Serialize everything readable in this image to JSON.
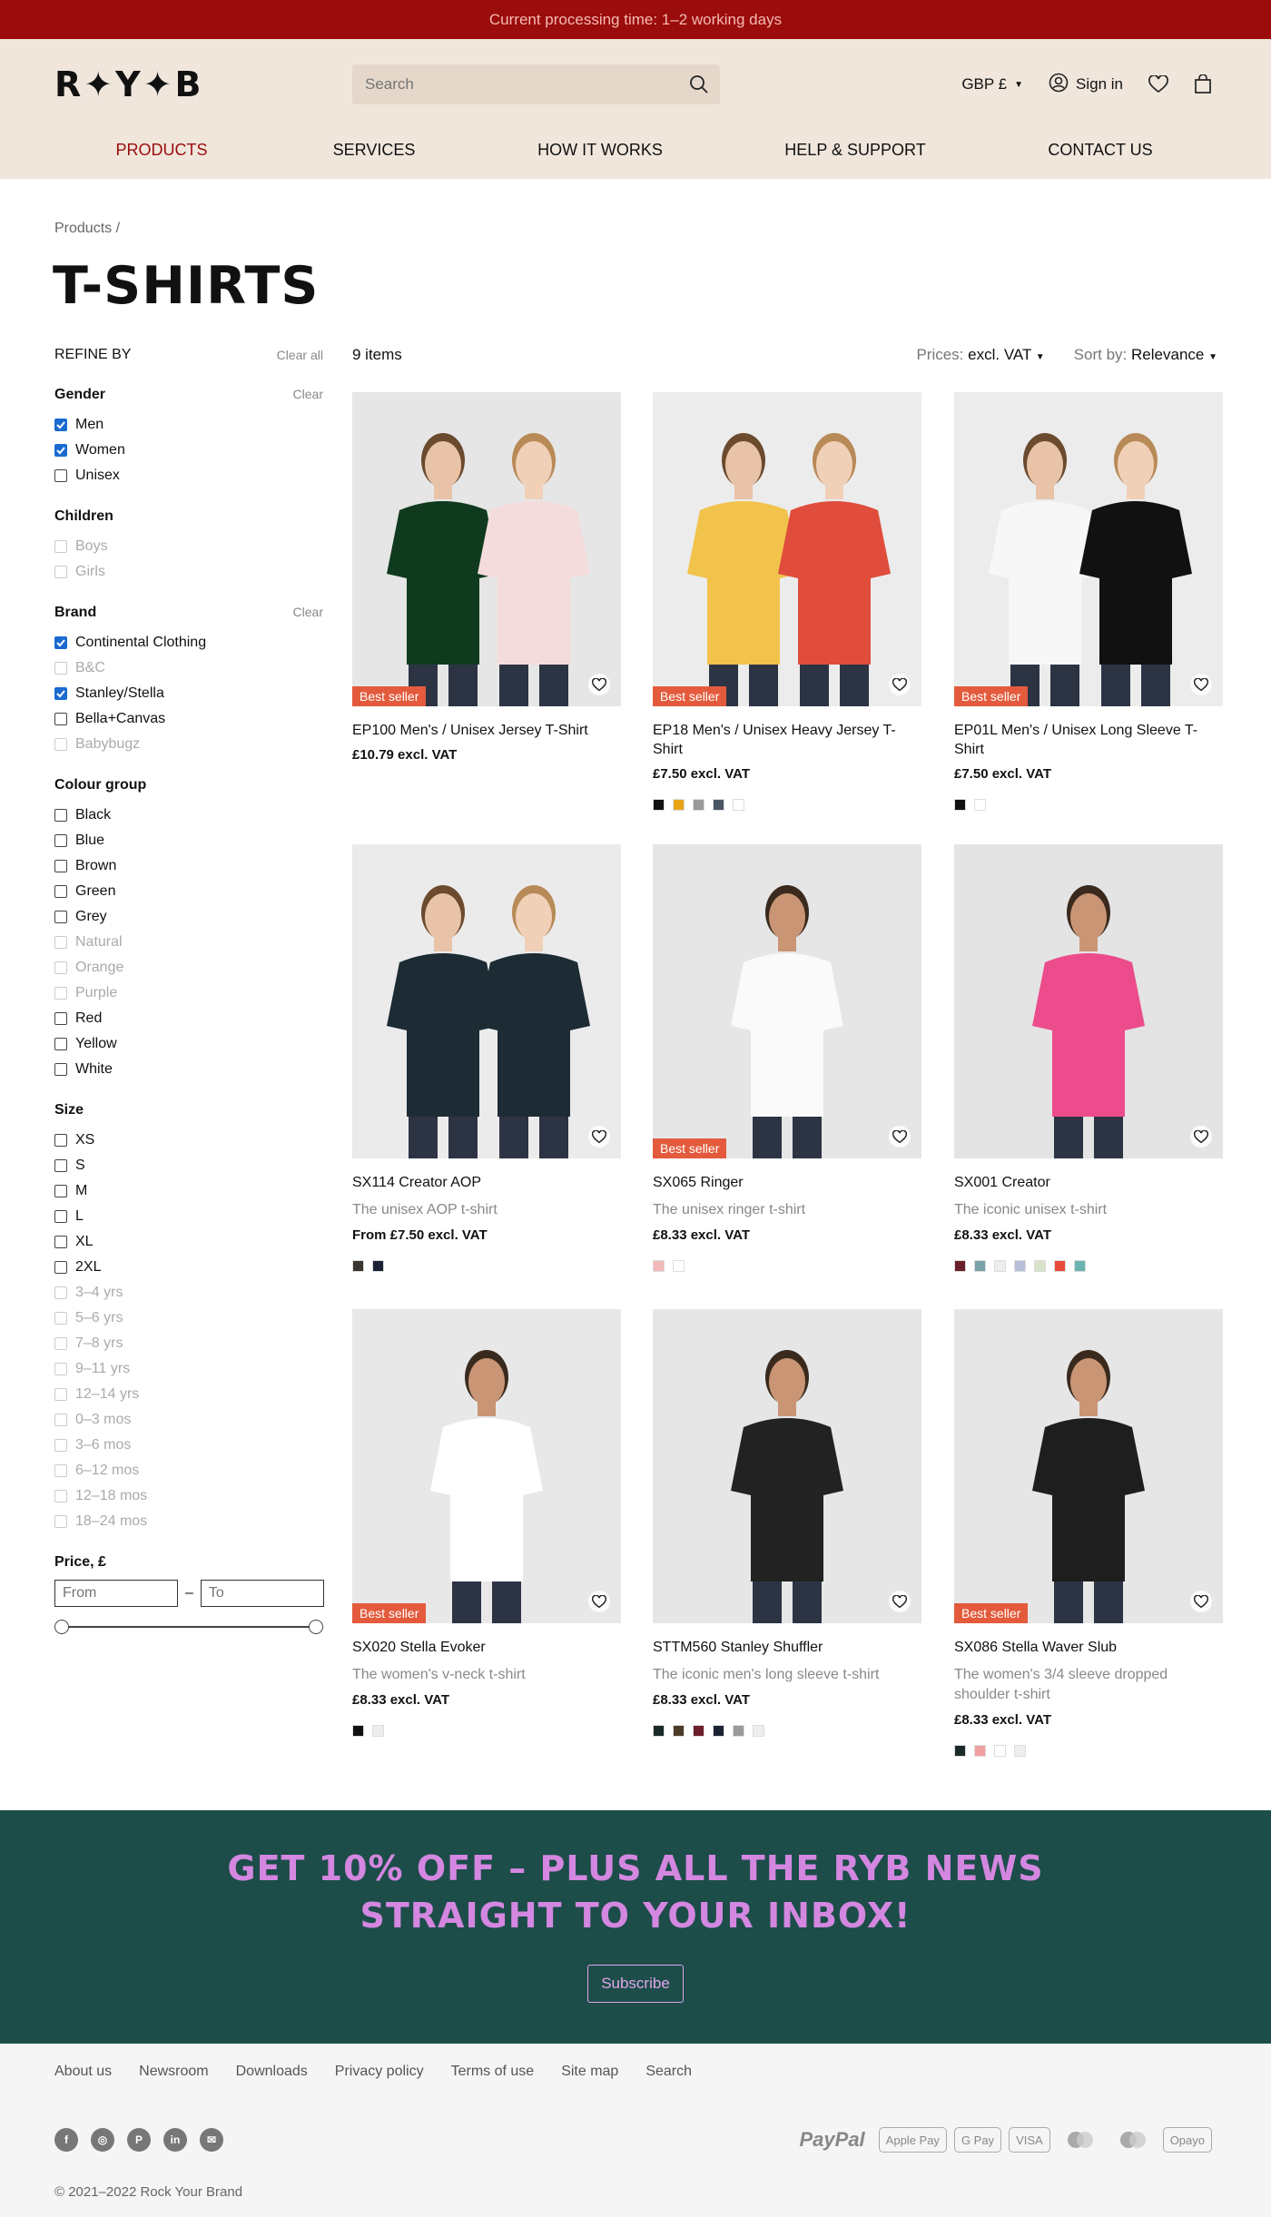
{
  "topbar": {
    "text": "Current processing time: 1–2 working days"
  },
  "header": {
    "logo": "R✦Y✦B",
    "search_placeholder": "Search",
    "currency": "GBP £",
    "sign_in": "Sign in"
  },
  "nav": [
    "PRODUCTS",
    "SERVICES",
    "HOW IT WORKS",
    "HELP & SUPPORT",
    "CONTACT US"
  ],
  "breadcrumb": "Products  /",
  "title": "T-SHIRTS",
  "refine": {
    "label": "REFINE BY",
    "clear_all": "Clear all",
    "clear": "Clear"
  },
  "filters": {
    "gender": {
      "label": "Gender",
      "options": [
        {
          "l": "Men",
          "c": true
        },
        {
          "l": "Women",
          "c": true
        },
        {
          "l": "Unisex"
        }
      ]
    },
    "children": {
      "label": "Children",
      "options": [
        {
          "l": "Boys",
          "d": true
        },
        {
          "l": "Girls",
          "d": true
        }
      ]
    },
    "brand": {
      "label": "Brand",
      "options": [
        {
          "l": "Continental Clothing",
          "c": true
        },
        {
          "l": "B&C",
          "d": true
        },
        {
          "l": "Stanley/Stella",
          "c": true
        },
        {
          "l": "Bella+Canvas"
        },
        {
          "l": "Babybugz",
          "d": true
        }
      ]
    },
    "colour": {
      "label": "Colour group",
      "options": [
        {
          "l": "Black"
        },
        {
          "l": "Blue"
        },
        {
          "l": "Brown"
        },
        {
          "l": "Green"
        },
        {
          "l": "Grey"
        },
        {
          "l": "Natural",
          "d": true
        },
        {
          "l": "Orange",
          "d": true
        },
        {
          "l": "Purple",
          "d": true
        },
        {
          "l": "Red"
        },
        {
          "l": "Yellow"
        },
        {
          "l": "White"
        }
      ]
    },
    "size": {
      "label": "Size",
      "options": [
        {
          "l": "XS"
        },
        {
          "l": "S"
        },
        {
          "l": "M"
        },
        {
          "l": "L"
        },
        {
          "l": "XL"
        },
        {
          "l": "2XL"
        },
        {
          "l": "3–4 yrs",
          "d": true
        },
        {
          "l": "5–6 yrs",
          "d": true
        },
        {
          "l": "7–8 yrs",
          "d": true
        },
        {
          "l": "9–11 yrs",
          "d": true
        },
        {
          "l": "12–14 yrs",
          "d": true
        },
        {
          "l": "0–3 mos",
          "d": true
        },
        {
          "l": "3–6 mos",
          "d": true
        },
        {
          "l": "6–12 mos",
          "d": true
        },
        {
          "l": "12–18 mos",
          "d": true
        },
        {
          "l": "18–24 mos",
          "d": true
        }
      ]
    },
    "price": {
      "label": "Price, £",
      "from": "From",
      "to": "To",
      "sep": "–"
    }
  },
  "toolbar": {
    "count": "9 items",
    "prices_label": "Prices:",
    "prices_value": "excl. VAT",
    "sort_label": "Sort by:",
    "sort_value": "Relevance"
  },
  "best_seller": "Best seller",
  "products": [
    {
      "name": "EP100 Men's / Unisex Jersey T-Shirt",
      "sub": "",
      "price": "£10.79 excl. VAT",
      "best": true,
      "bg": "#e6e6e6",
      "shirts": [
        "#0f3a1e",
        "#f5dcdc"
      ],
      "sw": []
    },
    {
      "name": "EP18 Men's / Unisex Heavy Jersey T-Shirt",
      "sub": "",
      "price": "£7.50 excl. VAT",
      "best": true,
      "bg": "#ececec",
      "shirts": [
        "#f2c34b",
        "#e04d3c"
      ],
      "sw": [
        "#111111",
        "#e8a317",
        "#999999",
        "#4a5566",
        "#ffffff"
      ]
    },
    {
      "name": "EP01L Men's / Unisex Long Sleeve T-Shirt",
      "sub": "",
      "price": "£7.50 excl. VAT",
      "best": true,
      "bg": "#ececec",
      "shirts": [
        "#f7f7f7",
        "#111111"
      ],
      "sw": [
        "#111111",
        "#ffffff"
      ]
    },
    {
      "name": "SX114 Creator AOP",
      "sub": "The unisex AOP t-shirt",
      "price": "From £7.50 excl. VAT",
      "best": false,
      "bg": "#ebebeb",
      "shirts": [
        "#1d2b35",
        "#1d2b35"
      ],
      "sw": [
        "#3a3530",
        "#1a2236"
      ]
    },
    {
      "name": "SX065 Ringer",
      "sub": "The unisex ringer t-shirt",
      "price": "£8.33 excl. VAT",
      "best": true,
      "bg": "#e6e6e6",
      "shirts": [
        "#fafafa"
      ],
      "sw": [
        "#f1b8b8",
        "#ffffff"
      ]
    },
    {
      "name": "SX001 Creator",
      "sub": "The iconic unisex t-shirt",
      "price": "£8.33 excl. VAT",
      "best": false,
      "bg": "#e4e4e4",
      "shirts": [
        "#ec4c8c"
      ],
      "sw": [
        "#6b1f2a",
        "#7aa0a8",
        "#eeeeee",
        "#b7bfd8",
        "#d7e2c9",
        "#e84a3c",
        "#6bb3b0"
      ]
    },
    {
      "name": "SX020 Stella Evoker",
      "sub": "The women's v-neck t-shirt",
      "price": "£8.33 excl. VAT",
      "best": true,
      "bg": "#e8e8e8",
      "shirts": [
        "#ffffff"
      ],
      "sw": [
        "#111111",
        "#eeeeee"
      ]
    },
    {
      "name": "STTM560 Stanley Shuffler",
      "sub": "The iconic men's long sleeve t-shirt",
      "price": "£8.33 excl. VAT",
      "best": false,
      "bg": "#e6e6e6",
      "shirts": [
        "#222222"
      ],
      "sw": [
        "#1a2a2a",
        "#4d3b2a",
        "#6b1f2a",
        "#1a2236",
        "#9a9a9a",
        "#eeeeee"
      ]
    },
    {
      "name": "SX086 Stella Waver Slub",
      "sub": "The women's 3/4 sleeve dropped shoulder t-shirt",
      "price": "£8.33 excl. VAT",
      "best": true,
      "bg": "#e6e6e6",
      "shirts": [
        "#1e1e1e"
      ],
      "sw": [
        "#1a2a2a",
        "#f1a0a0",
        "#ffffff",
        "#eeeeee"
      ]
    }
  ],
  "promo": {
    "line1": "GET 10% OFF – PLUS ALL THE RYB NEWS",
    "line2": "STRAIGHT TO YOUR INBOX!",
    "button": "Subscribe"
  },
  "footer": {
    "links": [
      "About us",
      "Newsroom",
      "Downloads",
      "Privacy policy",
      "Terms of use",
      "Site map",
      "Search"
    ],
    "social": [
      "f",
      "◎",
      "P",
      "in",
      "✉"
    ],
    "payments": [
      "PayPal",
      "Apple Pay",
      "G Pay",
      "VISA",
      "",
      "",
      "Opayo"
    ],
    "copyright": "© 2021–2022 Rock Your Brand"
  }
}
